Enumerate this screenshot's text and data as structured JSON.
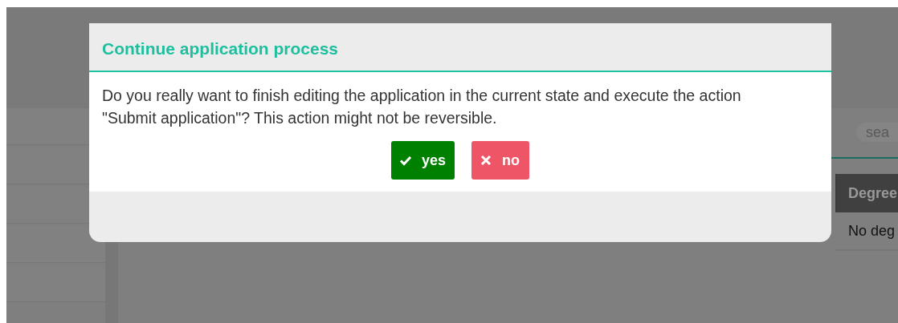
{
  "background": {
    "search": {
      "placeholder": "sea"
    },
    "table": {
      "columns": [
        "Degree"
      ],
      "rows": [
        [
          "No deg"
        ]
      ]
    }
  },
  "dialog": {
    "title": "Continue application process",
    "message": "Do you really want to finish editing the application in the current state and execute the action \"Submit application\"? This action might not be reversible.",
    "buttons": [
      {
        "label": "yes",
        "kind": "confirm"
      },
      {
        "label": "no",
        "kind": "cancel"
      }
    ]
  }
}
